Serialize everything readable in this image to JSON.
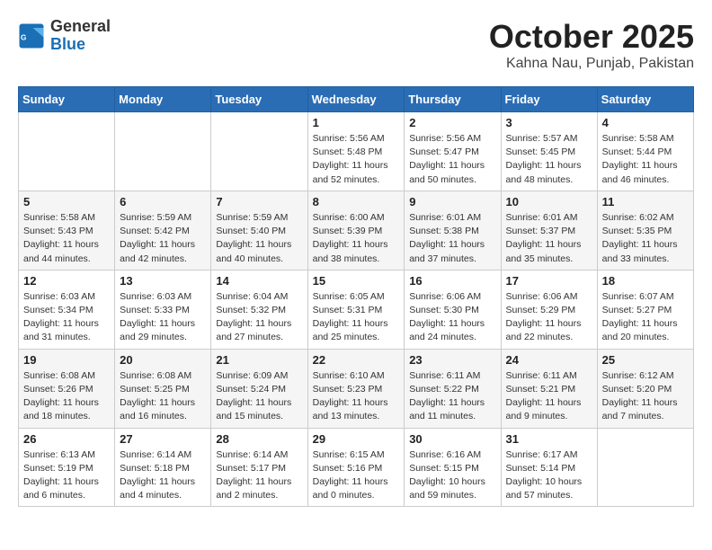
{
  "header": {
    "logo_general": "General",
    "logo_blue": "Blue",
    "month": "October 2025",
    "location": "Kahna Nau, Punjab, Pakistan"
  },
  "weekdays": [
    "Sunday",
    "Monday",
    "Tuesday",
    "Wednesday",
    "Thursday",
    "Friday",
    "Saturday"
  ],
  "weeks": [
    [
      {
        "day": "",
        "info": ""
      },
      {
        "day": "",
        "info": ""
      },
      {
        "day": "",
        "info": ""
      },
      {
        "day": "1",
        "info": "Sunrise: 5:56 AM\nSunset: 5:48 PM\nDaylight: 11 hours\nand 52 minutes."
      },
      {
        "day": "2",
        "info": "Sunrise: 5:56 AM\nSunset: 5:47 PM\nDaylight: 11 hours\nand 50 minutes."
      },
      {
        "day": "3",
        "info": "Sunrise: 5:57 AM\nSunset: 5:45 PM\nDaylight: 11 hours\nand 48 minutes."
      },
      {
        "day": "4",
        "info": "Sunrise: 5:58 AM\nSunset: 5:44 PM\nDaylight: 11 hours\nand 46 minutes."
      }
    ],
    [
      {
        "day": "5",
        "info": "Sunrise: 5:58 AM\nSunset: 5:43 PM\nDaylight: 11 hours\nand 44 minutes."
      },
      {
        "day": "6",
        "info": "Sunrise: 5:59 AM\nSunset: 5:42 PM\nDaylight: 11 hours\nand 42 minutes."
      },
      {
        "day": "7",
        "info": "Sunrise: 5:59 AM\nSunset: 5:40 PM\nDaylight: 11 hours\nand 40 minutes."
      },
      {
        "day": "8",
        "info": "Sunrise: 6:00 AM\nSunset: 5:39 PM\nDaylight: 11 hours\nand 38 minutes."
      },
      {
        "day": "9",
        "info": "Sunrise: 6:01 AM\nSunset: 5:38 PM\nDaylight: 11 hours\nand 37 minutes."
      },
      {
        "day": "10",
        "info": "Sunrise: 6:01 AM\nSunset: 5:37 PM\nDaylight: 11 hours\nand 35 minutes."
      },
      {
        "day": "11",
        "info": "Sunrise: 6:02 AM\nSunset: 5:35 PM\nDaylight: 11 hours\nand 33 minutes."
      }
    ],
    [
      {
        "day": "12",
        "info": "Sunrise: 6:03 AM\nSunset: 5:34 PM\nDaylight: 11 hours\nand 31 minutes."
      },
      {
        "day": "13",
        "info": "Sunrise: 6:03 AM\nSunset: 5:33 PM\nDaylight: 11 hours\nand 29 minutes."
      },
      {
        "day": "14",
        "info": "Sunrise: 6:04 AM\nSunset: 5:32 PM\nDaylight: 11 hours\nand 27 minutes."
      },
      {
        "day": "15",
        "info": "Sunrise: 6:05 AM\nSunset: 5:31 PM\nDaylight: 11 hours\nand 25 minutes."
      },
      {
        "day": "16",
        "info": "Sunrise: 6:06 AM\nSunset: 5:30 PM\nDaylight: 11 hours\nand 24 minutes."
      },
      {
        "day": "17",
        "info": "Sunrise: 6:06 AM\nSunset: 5:29 PM\nDaylight: 11 hours\nand 22 minutes."
      },
      {
        "day": "18",
        "info": "Sunrise: 6:07 AM\nSunset: 5:27 PM\nDaylight: 11 hours\nand 20 minutes."
      }
    ],
    [
      {
        "day": "19",
        "info": "Sunrise: 6:08 AM\nSunset: 5:26 PM\nDaylight: 11 hours\nand 18 minutes."
      },
      {
        "day": "20",
        "info": "Sunrise: 6:08 AM\nSunset: 5:25 PM\nDaylight: 11 hours\nand 16 minutes."
      },
      {
        "day": "21",
        "info": "Sunrise: 6:09 AM\nSunset: 5:24 PM\nDaylight: 11 hours\nand 15 minutes."
      },
      {
        "day": "22",
        "info": "Sunrise: 6:10 AM\nSunset: 5:23 PM\nDaylight: 11 hours\nand 13 minutes."
      },
      {
        "day": "23",
        "info": "Sunrise: 6:11 AM\nSunset: 5:22 PM\nDaylight: 11 hours\nand 11 minutes."
      },
      {
        "day": "24",
        "info": "Sunrise: 6:11 AM\nSunset: 5:21 PM\nDaylight: 11 hours\nand 9 minutes."
      },
      {
        "day": "25",
        "info": "Sunrise: 6:12 AM\nSunset: 5:20 PM\nDaylight: 11 hours\nand 7 minutes."
      }
    ],
    [
      {
        "day": "26",
        "info": "Sunrise: 6:13 AM\nSunset: 5:19 PM\nDaylight: 11 hours\nand 6 minutes."
      },
      {
        "day": "27",
        "info": "Sunrise: 6:14 AM\nSunset: 5:18 PM\nDaylight: 11 hours\nand 4 minutes."
      },
      {
        "day": "28",
        "info": "Sunrise: 6:14 AM\nSunset: 5:17 PM\nDaylight: 11 hours\nand 2 minutes."
      },
      {
        "day": "29",
        "info": "Sunrise: 6:15 AM\nSunset: 5:16 PM\nDaylight: 11 hours\nand 0 minutes."
      },
      {
        "day": "30",
        "info": "Sunrise: 6:16 AM\nSunset: 5:15 PM\nDaylight: 10 hours\nand 59 minutes."
      },
      {
        "day": "31",
        "info": "Sunrise: 6:17 AM\nSunset: 5:14 PM\nDaylight: 10 hours\nand 57 minutes."
      },
      {
        "day": "",
        "info": ""
      }
    ]
  ]
}
